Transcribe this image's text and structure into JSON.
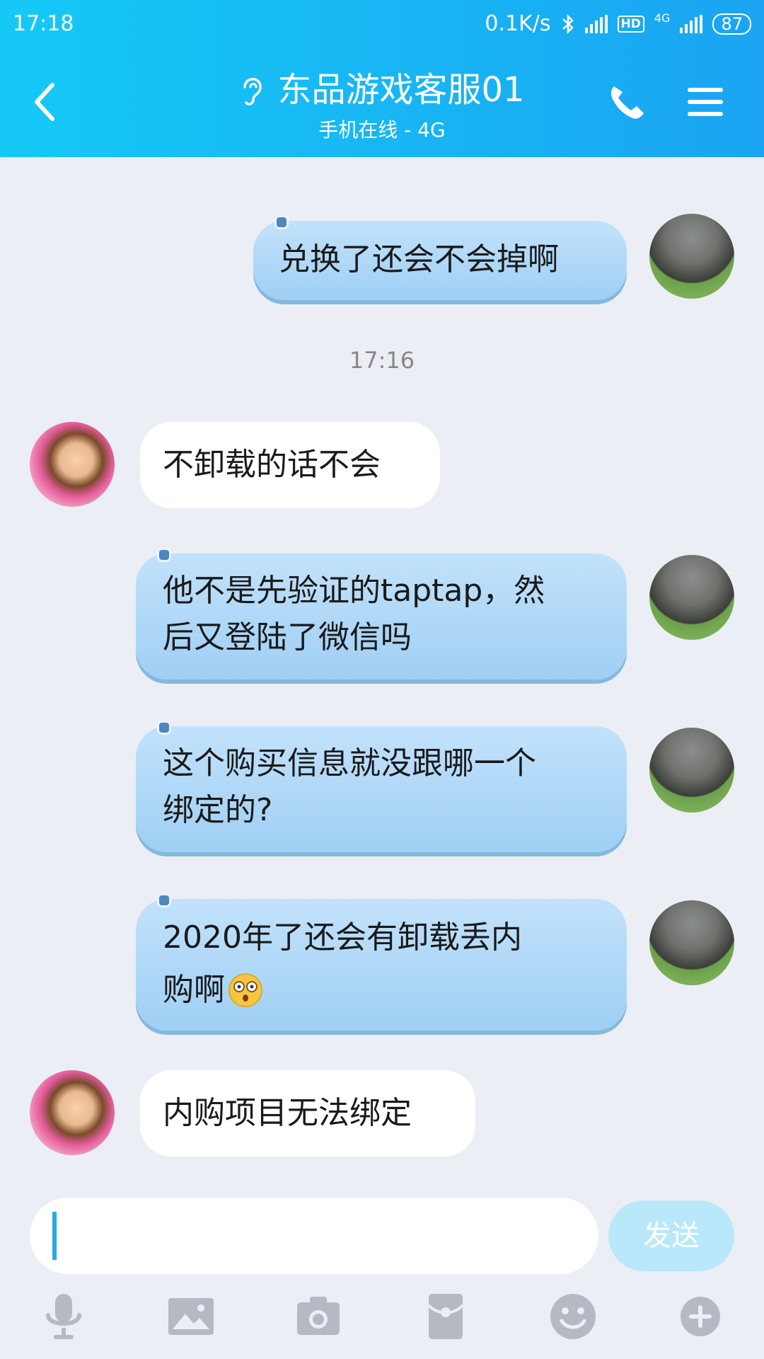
{
  "status": {
    "time": "17:18",
    "network_speed": "0.1K/s",
    "hd": "HD",
    "net_type": "4G",
    "battery": "87"
  },
  "header": {
    "title": "东品游戏客服01",
    "subtitle": "手机在线 - 4G"
  },
  "messages": [
    {
      "side": "out",
      "text": "兑换了还会不会掉啊"
    },
    {
      "side": "time",
      "text": "17:16"
    },
    {
      "side": "in",
      "text": "不卸载的话不会"
    },
    {
      "side": "out",
      "lines": [
        "他不是先验证的taptap，然",
        "后又登陆了微信吗"
      ]
    },
    {
      "side": "out",
      "lines": [
        "这个购买信息就没跟哪一个",
        "绑定的?"
      ]
    },
    {
      "side": "out",
      "lines": [
        "2020年了还会有卸载丢内",
        "购啊"
      ]
    },
    {
      "side": "in",
      "text": "内购项目无法绑定"
    }
  ],
  "input": {
    "value": "",
    "send_label": "发送"
  },
  "toolbar_icons": [
    "microphone-icon",
    "image-icon",
    "camera-icon",
    "red-packet-icon",
    "emoji-icon",
    "plus-icon"
  ],
  "colors": {
    "header_start": "#15c9f6",
    "header_end": "#1aa4f2",
    "bubble_out": "#a9d6f7",
    "send_button": "#b9e8fa",
    "toolbar_icon": "#b5b9c4"
  }
}
